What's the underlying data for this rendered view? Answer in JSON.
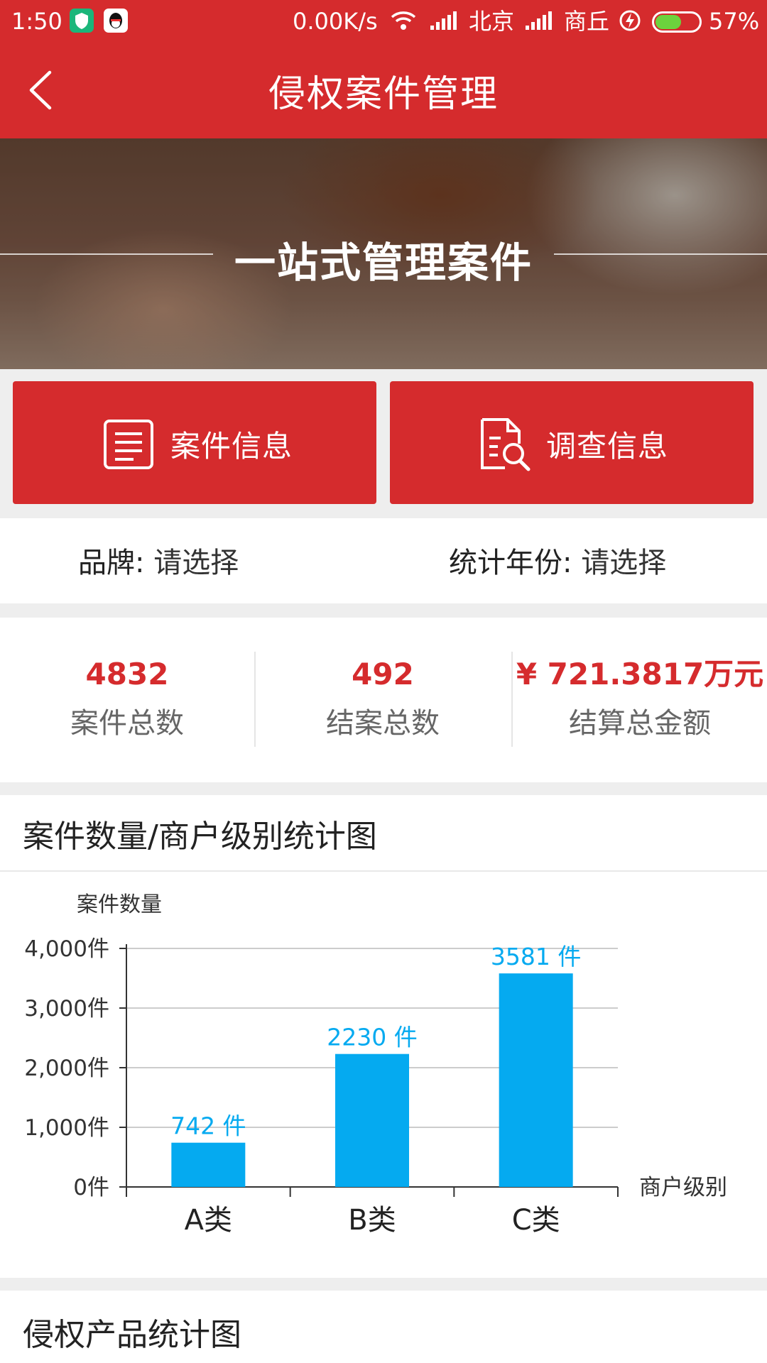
{
  "status_bar": {
    "time": "1:50",
    "net_speed": "0.00K/s",
    "carrier1": "北京",
    "carrier2": "商丘",
    "battery": "57%",
    "battery_level": 0.57
  },
  "header": {
    "title": "侵权案件管理"
  },
  "banner": {
    "text": "一站式管理案件"
  },
  "actions": [
    {
      "label": "案件信息",
      "icon": "document-list-icon"
    },
    {
      "label": "调查信息",
      "icon": "document-search-icon"
    }
  ],
  "filters": {
    "brand_label": "品牌:",
    "brand_value": "请选择",
    "year_label": "统计年份:",
    "year_value": "请选择"
  },
  "stats": [
    {
      "value": "4832",
      "caption": "案件总数"
    },
    {
      "value": "492",
      "caption": "结案总数"
    },
    {
      "value": "¥ 721.3817万元",
      "caption": "结算总金额"
    }
  ],
  "sections": {
    "chart_title": "案件数量/商户级别统计图",
    "next_title": "侵权产品统计图"
  },
  "colors": {
    "primary": "#d52b2d",
    "bar": "#05aaf0",
    "page_bg": "#eeeeee"
  },
  "chart_data": {
    "type": "bar",
    "categories": [
      "A类",
      "B类",
      "C类"
    ],
    "values": [
      742,
      2230,
      3581
    ],
    "data_labels": [
      "742 件",
      "2230 件",
      "3581 件"
    ],
    "ylabel": "案件数量",
    "xlabel": "商户级别",
    "ylim": [
      0,
      4000
    ],
    "yticks": [
      0,
      1000,
      2000,
      3000,
      4000
    ],
    "ytick_labels": [
      "0件",
      "1,000件",
      "2,000件",
      "3,000件",
      "4,000件"
    ],
    "grid": true
  }
}
